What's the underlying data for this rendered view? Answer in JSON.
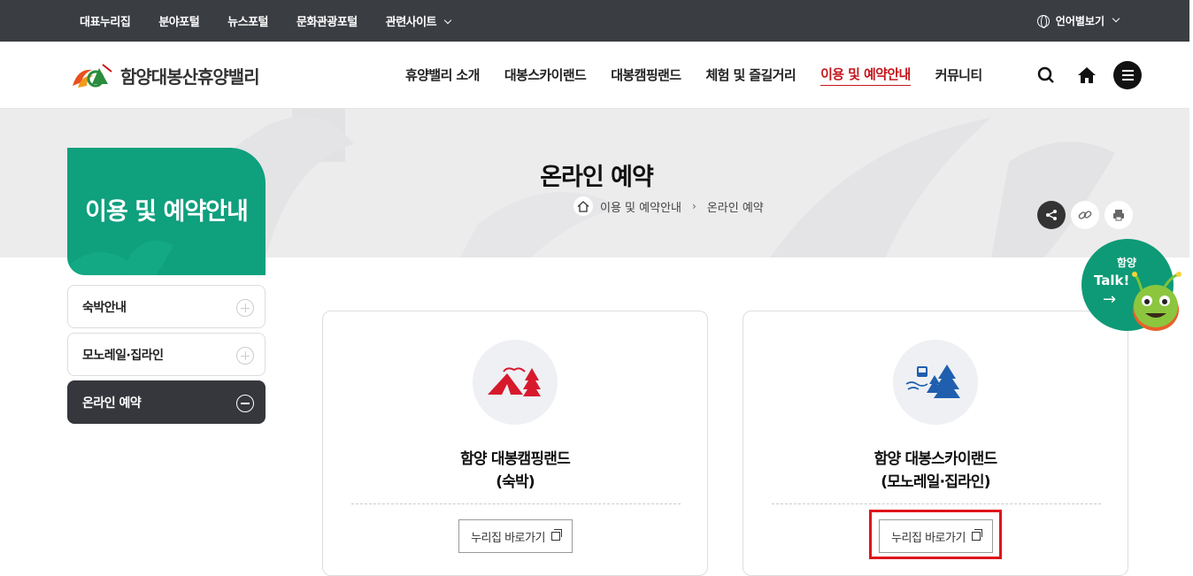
{
  "topbar": {
    "links": [
      "대표누리집",
      "분야포털",
      "뉴스포털",
      "문화관광포털",
      "관련사이트"
    ],
    "language": "언어별보기"
  },
  "header": {
    "logo_text": "함양대봉산휴양밸리",
    "nav": [
      "휴양밸리 소개",
      "대봉스카이랜드",
      "대봉캠핑랜드",
      "체험 및 즐길거리",
      "이용 및 예약안내",
      "커뮤니티"
    ],
    "active_nav": "이용 및 예약안내"
  },
  "hero": {
    "title": "온라인 예약",
    "breadcrumb": [
      "이용 및 예약안내",
      "온라인 예약"
    ]
  },
  "sidebar": {
    "title": "이용 및 예약안내",
    "items": [
      {
        "label": "숙박안내",
        "active": false
      },
      {
        "label": "모노레일·집라인",
        "active": false
      },
      {
        "label": "온라인 예약",
        "active": true
      }
    ]
  },
  "cards": [
    {
      "title_line1": "함양 대봉캠핑랜드",
      "title_line2": "(숙박)",
      "button": "누리집 바로가기",
      "icon": "camping-tent-icon"
    },
    {
      "title_line1": "함양 대봉스카이랜드",
      "title_line2": "(모노레일·집라인)",
      "button": "누리집 바로가기",
      "icon": "monorail-forest-icon"
    }
  ],
  "talk": {
    "small": "함양",
    "big": "Talk!",
    "arrow": "→"
  },
  "colors": {
    "accent": "#0fa07e",
    "active_nav": "#c4161c",
    "topbar": "#3a3d42",
    "highlight": "#e0131b"
  }
}
